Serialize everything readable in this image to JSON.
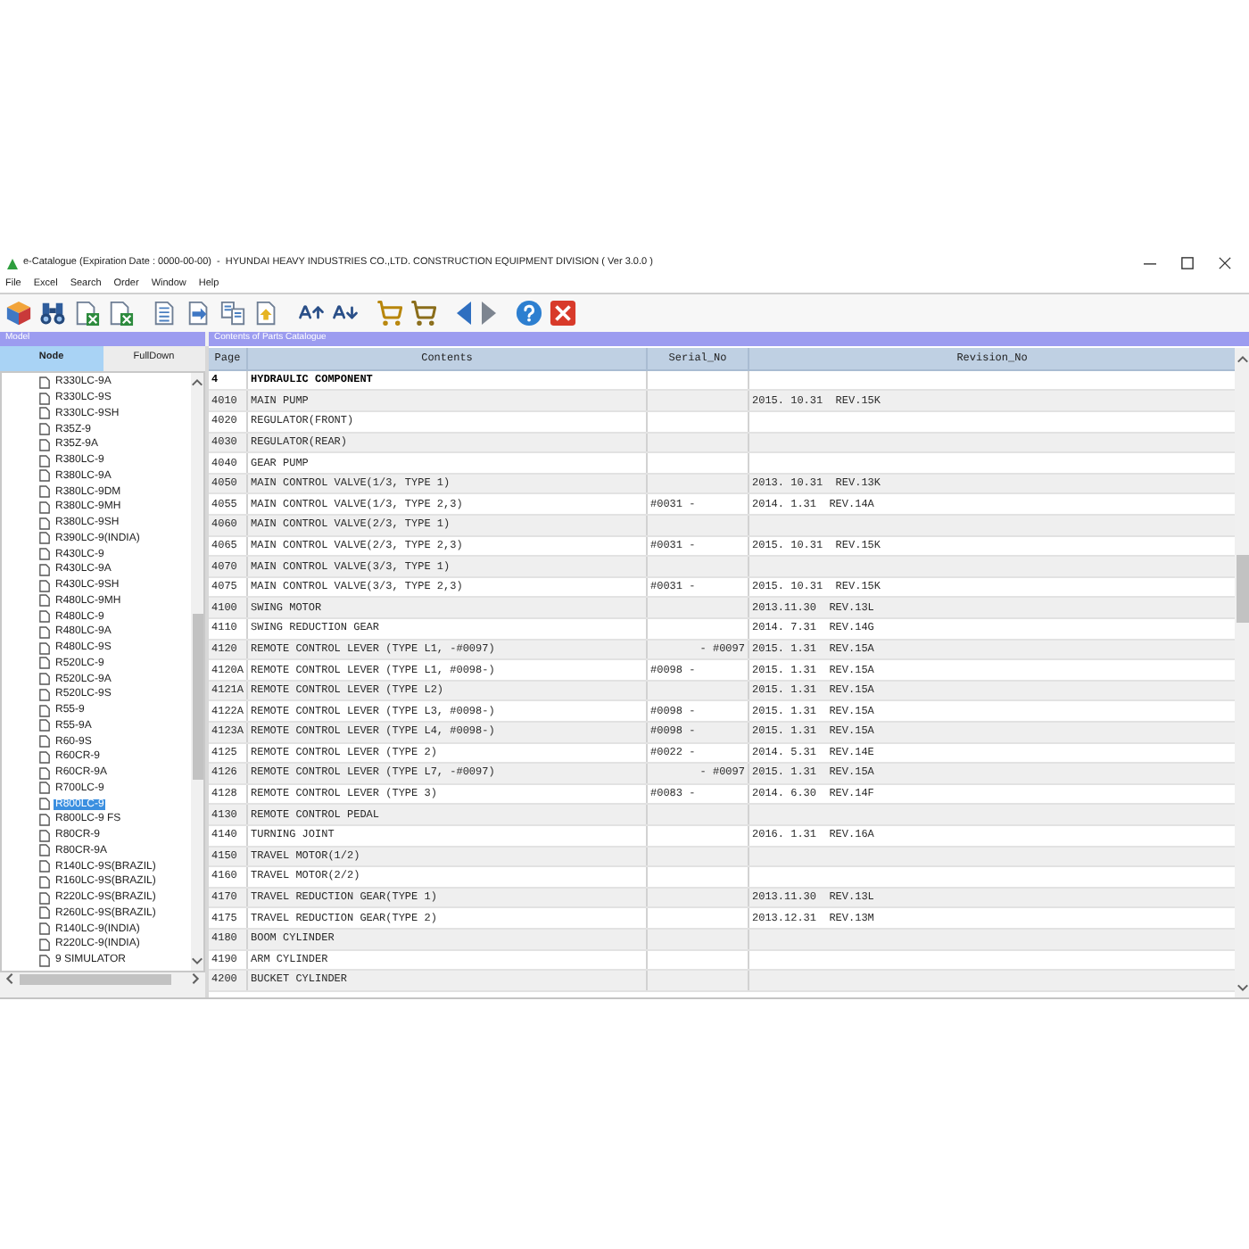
{
  "window": {
    "title": "e-Catalogue (Expiration Date : 0000-00-00)  -  HYUNDAI HEAVY INDUSTRIES CO.,LTD. CONSTRUCTION EQUIPMENT DIVISION ( Ver 3.0.0 )"
  },
  "menu": [
    "File",
    "Excel",
    "Search",
    "Order",
    "Window",
    "Help"
  ],
  "left_panel": {
    "header": "Model",
    "tabs": [
      {
        "label": "Node",
        "selected": true
      },
      {
        "label": "FullDown",
        "selected": false
      }
    ],
    "tree": [
      {
        "label": "R330LC-9A",
        "selected": false
      },
      {
        "label": "R330LC-9S",
        "selected": false
      },
      {
        "label": "R330LC-9SH",
        "selected": false
      },
      {
        "label": "R35Z-9",
        "selected": false
      },
      {
        "label": "R35Z-9A",
        "selected": false
      },
      {
        "label": "R380LC-9",
        "selected": false
      },
      {
        "label": "R380LC-9A",
        "selected": false
      },
      {
        "label": "R380LC-9DM",
        "selected": false
      },
      {
        "label": "R380LC-9MH",
        "selected": false
      },
      {
        "label": "R380LC-9SH",
        "selected": false
      },
      {
        "label": "R390LC-9(INDIA)",
        "selected": false
      },
      {
        "label": "R430LC-9",
        "selected": false
      },
      {
        "label": "R430LC-9A",
        "selected": false
      },
      {
        "label": "R430LC-9SH",
        "selected": false
      },
      {
        "label": "R480LC-9MH",
        "selected": false
      },
      {
        "label": "R480LC-9",
        "selected": false
      },
      {
        "label": "R480LC-9A",
        "selected": false
      },
      {
        "label": "R480LC-9S",
        "selected": false
      },
      {
        "label": "R520LC-9",
        "selected": false
      },
      {
        "label": "R520LC-9A",
        "selected": false
      },
      {
        "label": "R520LC-9S",
        "selected": false
      },
      {
        "label": "R55-9",
        "selected": false
      },
      {
        "label": "R55-9A",
        "selected": false
      },
      {
        "label": "R60-9S",
        "selected": false
      },
      {
        "label": "R60CR-9",
        "selected": false
      },
      {
        "label": "R60CR-9A",
        "selected": false
      },
      {
        "label": "R700LC-9",
        "selected": false
      },
      {
        "label": "R800LC-9",
        "selected": true
      },
      {
        "label": "R800LC-9 FS",
        "selected": false
      },
      {
        "label": "R80CR-9",
        "selected": false
      },
      {
        "label": "R80CR-9A",
        "selected": false
      },
      {
        "label": "R140LC-9S(BRAZIL)",
        "selected": false
      },
      {
        "label": "R160LC-9S(BRAZIL)",
        "selected": false
      },
      {
        "label": "R220LC-9S(BRAZIL)",
        "selected": false
      },
      {
        "label": "R260LC-9S(BRAZIL)",
        "selected": false
      },
      {
        "label": "R140LC-9(INDIA)",
        "selected": false
      },
      {
        "label": "R220LC-9(INDIA)",
        "selected": false
      },
      {
        "label": "9 SIMULATOR",
        "selected": false
      }
    ]
  },
  "parts_panel": {
    "header": "Contents of Parts Catalogue",
    "columns": [
      "Page",
      "Contents",
      "Serial_No",
      "Revision_No"
    ],
    "rows": [
      {
        "kind": "section",
        "page": "4",
        "contents": "HYDRAULIC COMPONENT"
      },
      {
        "kind": "part",
        "page": "4010",
        "contents": "MAIN PUMP",
        "revision": "2015. 10.31  REV.15K"
      },
      {
        "kind": "part",
        "page": "4020",
        "contents": "REGULATOR(FRONT)"
      },
      {
        "kind": "part",
        "page": "4030",
        "contents": "REGULATOR(REAR)"
      },
      {
        "kind": "part",
        "page": "4040",
        "contents": "GEAR PUMP"
      },
      {
        "kind": "part",
        "page": "4050",
        "contents": "MAIN CONTROL VALVE(1/3, TYPE 1)",
        "revision": "2013. 10.31  REV.13K"
      },
      {
        "kind": "part",
        "page": "4055",
        "contents": "MAIN CONTROL VALVE(1/3, TYPE 2,3)",
        "serial": "#0031 -",
        "serial_right_aligned": false,
        "revision": "2014. 1.31  REV.14A"
      },
      {
        "kind": "part",
        "page": "4060",
        "contents": "MAIN CONTROL VALVE(2/3, TYPE 1)"
      },
      {
        "kind": "part",
        "page": "4065",
        "contents": "MAIN CONTROL VALVE(2/3, TYPE 2,3)",
        "serial": "#0031 -",
        "serial_right_aligned": false,
        "revision": "2015. 10.31  REV.15K"
      },
      {
        "kind": "part",
        "page": "4070",
        "contents": "MAIN CONTROL VALVE(3/3, TYPE 1)"
      },
      {
        "kind": "part",
        "page": "4075",
        "contents": "MAIN CONTROL VALVE(3/3, TYPE 2,3)",
        "serial": "#0031 -",
        "serial_right_aligned": false,
        "revision": "2015. 10.31  REV.15K"
      },
      {
        "kind": "part",
        "page": "4100",
        "contents": "SWING MOTOR",
        "revision": "2013.11.30  REV.13L"
      },
      {
        "kind": "part",
        "page": "4110",
        "contents": "SWING REDUCTION GEAR",
        "revision": "2014. 7.31  REV.14G"
      },
      {
        "kind": "part",
        "page": "4120",
        "contents": "REMOTE CONTROL LEVER (TYPE L1, -#0097)",
        "serial": "- #0097",
        "serial_right_aligned": true,
        "revision": "2015. 1.31  REV.15A"
      },
      {
        "kind": "part",
        "page": "4120A",
        "contents": "REMOTE CONTROL LEVER (TYPE L1, #0098-)",
        "serial": "#0098 -",
        "serial_right_aligned": false,
        "revision": "2015. 1.31  REV.15A"
      },
      {
        "kind": "part",
        "page": "4121A",
        "contents": "REMOTE CONTROL LEVER (TYPE L2)",
        "revision": "2015. 1.31  REV.15A"
      },
      {
        "kind": "part",
        "page": "4122A",
        "contents": "REMOTE CONTROL LEVER (TYPE L3, #0098-)",
        "serial": "#0098 -",
        "serial_right_aligned": false,
        "revision": "2015. 1.31  REV.15A"
      },
      {
        "kind": "part",
        "page": "4123A",
        "contents": "REMOTE CONTROL LEVER (TYPE L4, #0098-)",
        "serial": "#0098 -",
        "serial_right_aligned": false,
        "revision": "2015. 1.31  REV.15A"
      },
      {
        "kind": "part",
        "page": "4125",
        "contents": "REMOTE CONTROL LEVER (TYPE 2)",
        "serial": "#0022 -",
        "serial_right_aligned": false,
        "revision": "2014. 5.31  REV.14E"
      },
      {
        "kind": "part",
        "page": "4126",
        "contents": "REMOTE CONTROL LEVER (TYPE L7, -#0097)",
        "serial": "- #0097",
        "serial_right_aligned": true,
        "revision": "2015. 1.31  REV.15A"
      },
      {
        "kind": "part",
        "page": "4128",
        "contents": "REMOTE CONTROL LEVER (TYPE 3)",
        "serial": "#0083 -",
        "serial_right_aligned": false,
        "revision": "2014. 6.30  REV.14F"
      },
      {
        "kind": "part",
        "page": "4130",
        "contents": "REMOTE CONTROL PEDAL"
      },
      {
        "kind": "part",
        "page": "4140",
        "contents": "TURNING JOINT",
        "revision": "2016. 1.31  REV.16A"
      },
      {
        "kind": "part",
        "page": "4150",
        "contents": "TRAVEL MOTOR(1/2)"
      },
      {
        "kind": "part",
        "page": "4160",
        "contents": "TRAVEL MOTOR(2/2)"
      },
      {
        "kind": "part",
        "page": "4170",
        "contents": "TRAVEL REDUCTION GEAR(TYPE 1)",
        "revision": "2013.11.30  REV.13L"
      },
      {
        "kind": "part",
        "page": "4175",
        "contents": "TRAVEL REDUCTION GEAR(TYPE 2)",
        "revision": "2013.12.31  REV.13M"
      },
      {
        "kind": "part",
        "page": "4180",
        "contents": "BOOM CYLINDER"
      },
      {
        "kind": "part",
        "page": "4190",
        "contents": "ARM CYLINDER"
      },
      {
        "kind": "part",
        "page": "4200",
        "contents": "BUCKET CYLINDER"
      }
    ]
  }
}
